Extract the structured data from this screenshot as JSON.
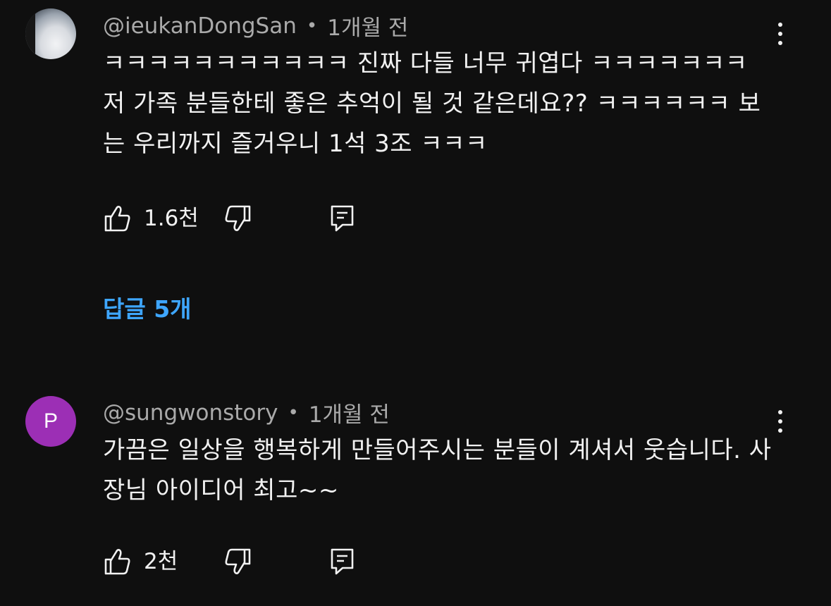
{
  "comments": [
    {
      "handle": "@ieukanDongSan",
      "separator": "•",
      "time": "1개월 전",
      "text": "ㅋㅋㅋㅋㅋㅋㅋㅋㅋㅋㅋ 진짜 다들 너무 귀엽다 ㅋㅋㅋㅋㅋㅋㅋ 저 가족 분들한테 좋은 추억이 될 것 같은데요?? ㅋㅋㅋㅋㅋㅋ 보는 우리까지 즐거우니 1석 3조 ㅋㅋㅋ",
      "likes": "1.6천",
      "replies_label": "답글 5개"
    },
    {
      "handle": "@sungwonstory",
      "separator": "•",
      "avatar_letter": "P",
      "avatar_color": "#9c2fb5",
      "time": "1개월 전",
      "text": "가끔은 일상을 행복하게 만들어주시는 분들이 계셔서 웃습니다. 사장님 아이디어 최고~~",
      "likes": "2천"
    }
  ],
  "colors": {
    "background": "#0f0f0f",
    "text": "#f1f1f1",
    "meta": "#aaaaaa",
    "link": "#3ea6ff"
  },
  "icons": [
    "thumbs-up-icon",
    "thumbs-down-icon",
    "reply-icon",
    "more-vert-icon"
  ]
}
